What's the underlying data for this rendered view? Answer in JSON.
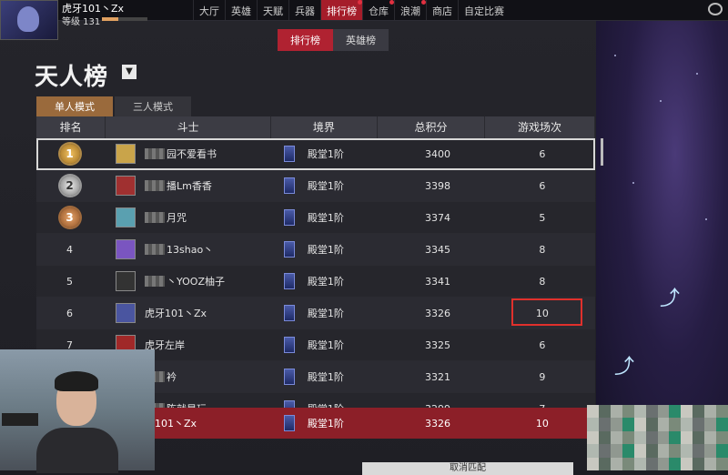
{
  "header": {
    "username": "虎牙101丶Zx",
    "level_label": "等级 131",
    "xp_fraction": 0.35
  },
  "nav": {
    "items": [
      "大厅",
      "英雄",
      "天赋",
      "兵器",
      "排行榜",
      "仓库",
      "浪潮",
      "商店",
      "自定比赛"
    ],
    "active_index": 4
  },
  "subtabs": {
    "items": [
      "排行榜",
      "英雄榜"
    ],
    "active_index": 0
  },
  "page": {
    "title": "天人榜",
    "dropdown_icon": "caret-down-icon"
  },
  "mode_tabs": {
    "items": [
      "单人模式",
      "三人模式"
    ],
    "active_index": 0
  },
  "table": {
    "headers": [
      "排名",
      "斗士",
      "境界",
      "总积分",
      "游戏场次"
    ],
    "rows": [
      {
        "rank": "1",
        "name": "园不爱看书",
        "realm": "殿堂1阶",
        "score": "3400",
        "games": "6"
      },
      {
        "rank": "2",
        "name": "播Lm香香",
        "realm": "殿堂1阶",
        "score": "3398",
        "games": "6"
      },
      {
        "rank": "3",
        "name": "月咒",
        "realm": "殿堂1阶",
        "score": "3374",
        "games": "5"
      },
      {
        "rank": "4",
        "name": "13shao丶",
        "realm": "殿堂1阶",
        "score": "3345",
        "games": "8"
      },
      {
        "rank": "5",
        "name": "丶YOOZ柚子",
        "realm": "殿堂1阶",
        "score": "3341",
        "games": "8"
      },
      {
        "rank": "6",
        "name": "虎牙101丶Zx",
        "realm": "殿堂1阶",
        "score": "3326",
        "games": "10"
      },
      {
        "rank": "7",
        "name": "虎牙左岸",
        "realm": "殿堂1阶",
        "score": "3325",
        "games": "6"
      },
      {
        "rank": "",
        "name": "衿",
        "realm": "殿堂1阶",
        "score": "3321",
        "games": "9"
      },
      {
        "rank": "",
        "name": "陈就是玩",
        "realm": "殿堂1阶",
        "score": "3299",
        "games": "7"
      }
    ],
    "self_row": {
      "rank": "",
      "name": "牙101丶Zx",
      "realm": "殿堂1阶",
      "score": "3326",
      "games": "10"
    }
  },
  "footer": {
    "cancel_label": "取消匹配"
  },
  "colors": {
    "accent_red": "#b02231",
    "highlight_box": "#e0302c",
    "mode_active": "#9a6a3c"
  }
}
